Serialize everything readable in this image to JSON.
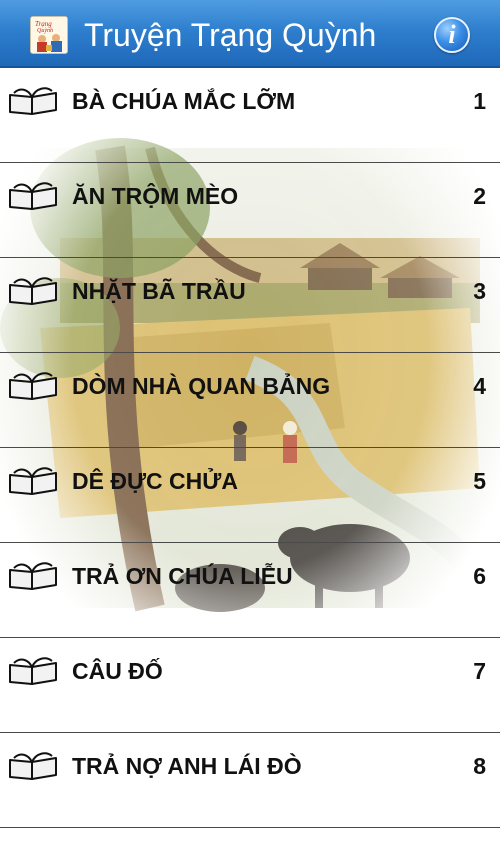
{
  "app": {
    "title": "Truyện Trạng Quỳnh",
    "logo_icon": "book-cover-icon",
    "info_icon": "info-icon",
    "accent_color": "#2f7fcf"
  },
  "stories": [
    {
      "title": "BÀ CHÚA MẮC LỠM",
      "number": "1"
    },
    {
      "title": "ĂN TRỘM MÈO",
      "number": "2"
    },
    {
      "title": "NHẶT BÃ TRẦU",
      "number": "3"
    },
    {
      "title": "DÒM NHÀ QUAN BẢNG",
      "number": "4"
    },
    {
      "title": "DÊ ĐỰC CHỬA",
      "number": "5"
    },
    {
      "title": "TRẢ ƠN CHÚA LIỄU",
      "number": "6"
    },
    {
      "title": "CÂU ĐỐ",
      "number": "7"
    },
    {
      "title": "TRẢ NỢ ANH LÁI ĐÒ",
      "number": "8"
    }
  ]
}
